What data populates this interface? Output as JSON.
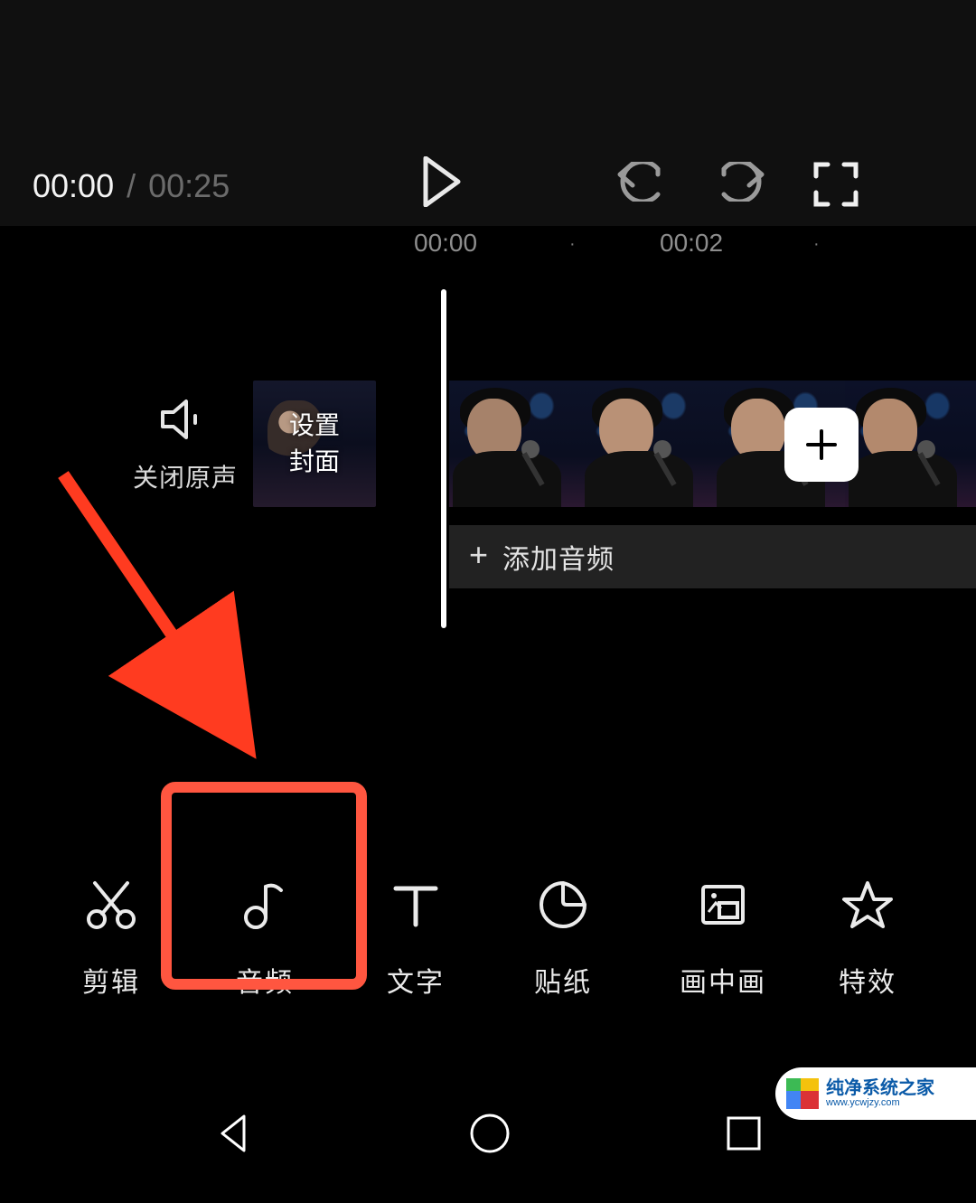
{
  "player": {
    "current_time": "00:00",
    "separator": "/",
    "total_time": "00:25"
  },
  "ruler": {
    "tick1": "00:00",
    "tick2": "00:02"
  },
  "mute": {
    "label": "关闭原声",
    "icon": "speaker-icon"
  },
  "cover": {
    "line1": "设置",
    "line2": "封面"
  },
  "add_clip": {
    "icon": "plus-icon"
  },
  "add_audio": {
    "plus": "+",
    "label": "添加音频"
  },
  "toolbar": {
    "edit": {
      "label": "剪辑",
      "icon": "scissors-icon"
    },
    "audio": {
      "label": "音频",
      "icon": "music-note-icon"
    },
    "text": {
      "label": "文字",
      "icon": "text-icon"
    },
    "sticker": {
      "label": "贴纸",
      "icon": "sticker-icon"
    },
    "pip": {
      "label": "画中画",
      "icon": "picture-in-picture-icon"
    },
    "effect": {
      "label": "特效",
      "icon": "star-icon"
    }
  },
  "watermark": {
    "title": "纯净系统之家",
    "url": "www.ycwjzy.com"
  },
  "annotation": {
    "highlight_target": "toolbar.audio",
    "highlight_color": "#ff5640"
  }
}
